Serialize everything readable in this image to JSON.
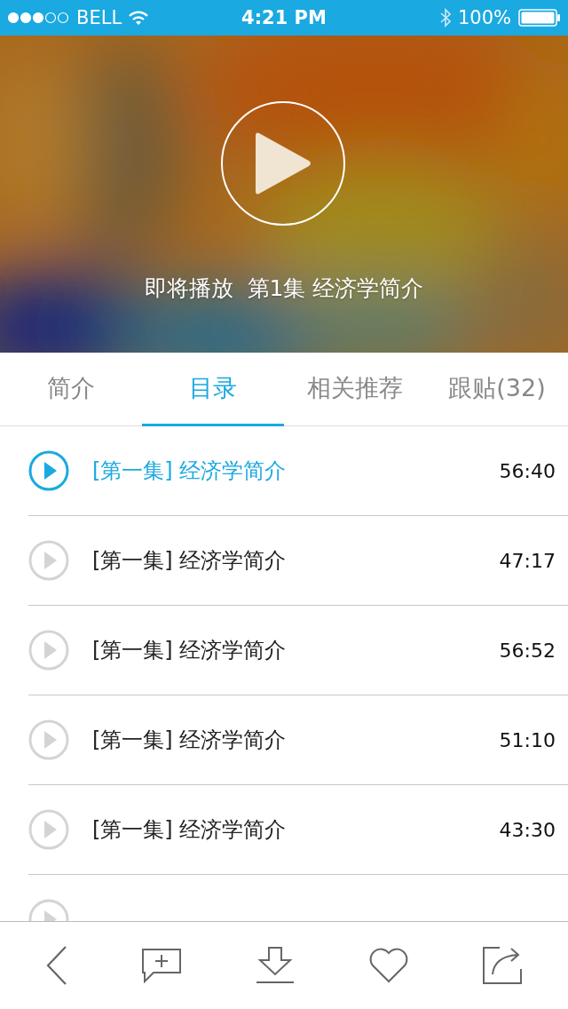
{
  "status_bar": {
    "carrier": "BELL",
    "time": "4:21 PM",
    "battery": "100%"
  },
  "player": {
    "caption": "即将播放  第1集 经济学简介"
  },
  "tabs": [
    {
      "label": "简介",
      "selected": false
    },
    {
      "label": "目录",
      "selected": true
    },
    {
      "label": "相关推荐",
      "selected": false
    },
    {
      "label": "跟贴(32)",
      "selected": false
    }
  ],
  "episodes": [
    {
      "title": "[第一集] 经济学简介",
      "duration": "56:40",
      "selected": true
    },
    {
      "title": "[第一集] 经济学简介",
      "duration": "47:17",
      "selected": false
    },
    {
      "title": "[第一集] 经济学简介",
      "duration": "56:52",
      "selected": false
    },
    {
      "title": "[第一集] 经济学简介",
      "duration": "51:10",
      "selected": false
    },
    {
      "title": "[第一集] 经济学简介",
      "duration": "43:30",
      "selected": false
    },
    {
      "selected": false
    }
  ]
}
